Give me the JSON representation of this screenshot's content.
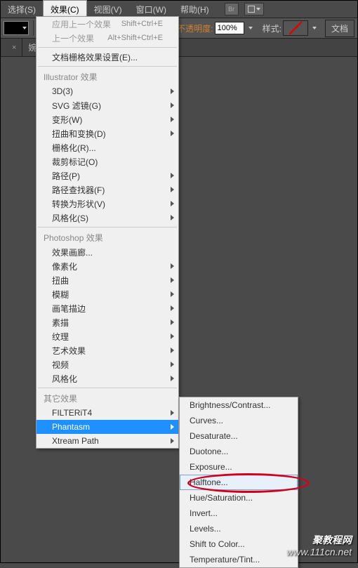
{
  "menubar": {
    "items": [
      {
        "label": "选择(S)"
      },
      {
        "label": "效果(C)"
      },
      {
        "label": "视图(V)"
      },
      {
        "label": "窗口(W)"
      },
      {
        "label": "帮助(H)"
      }
    ],
    "br_icon": "Br"
  },
  "optionsbar": {
    "opacity_label": "不透明度:",
    "opacity_value": "100%",
    "style_label": "样式:",
    "doc_btn": "文档"
  },
  "filetabs": {
    "tab1": "",
    "tab2": "婉",
    "close": "×"
  },
  "menu": {
    "apply_last": "应用上一个效果",
    "apply_last_sc": "Shift+Ctrl+E",
    "last": "上一个效果",
    "last_sc": "Alt+Shift+Ctrl+E",
    "doc_raster": "文档栅格效果设置(E)...",
    "header_illustrator": "Illustrator 效果",
    "items_illustrator": [
      {
        "label": "3D(3)",
        "sub": true
      },
      {
        "label": "SVG 滤镜(G)",
        "sub": true
      },
      {
        "label": "变形(W)",
        "sub": true
      },
      {
        "label": "扭曲和变换(D)",
        "sub": true
      },
      {
        "label": "栅格化(R)..."
      },
      {
        "label": "裁剪标记(O)"
      },
      {
        "label": "路径(P)",
        "sub": true
      },
      {
        "label": "路径查找器(F)",
        "sub": true
      },
      {
        "label": "转换为形状(V)",
        "sub": true
      },
      {
        "label": "风格化(S)",
        "sub": true
      }
    ],
    "header_photoshop": "Photoshop 效果",
    "items_photoshop": [
      {
        "label": "效果画廊..."
      },
      {
        "label": "像素化",
        "sub": true
      },
      {
        "label": "扭曲",
        "sub": true
      },
      {
        "label": "模糊",
        "sub": true
      },
      {
        "label": "画笔描边",
        "sub": true
      },
      {
        "label": "素描",
        "sub": true
      },
      {
        "label": "纹理",
        "sub": true
      },
      {
        "label": "艺术效果",
        "sub": true
      },
      {
        "label": "视频",
        "sub": true
      },
      {
        "label": "风格化",
        "sub": true
      }
    ],
    "header_other": "其它效果",
    "items_other": [
      {
        "label": "FILTERiT4",
        "sub": true
      },
      {
        "label": "Phantasm",
        "sub": true,
        "highlight": true
      },
      {
        "label": "Xtream Path",
        "sub": true
      }
    ]
  },
  "submenu": {
    "items": [
      {
        "label": "Brightness/Contrast..."
      },
      {
        "label": "Curves..."
      },
      {
        "label": "Desaturate..."
      },
      {
        "label": "Duotone..."
      },
      {
        "label": "Exposure..."
      },
      {
        "label": "Halftone...",
        "hover": true
      },
      {
        "label": "Hue/Saturation..."
      },
      {
        "label": "Invert..."
      },
      {
        "label": "Levels..."
      },
      {
        "label": "Shift to Color..."
      },
      {
        "label": "Temperature/Tint..."
      }
    ]
  },
  "watermark": {
    "line1": "聚教程网",
    "line2": "www.111cn.net"
  }
}
